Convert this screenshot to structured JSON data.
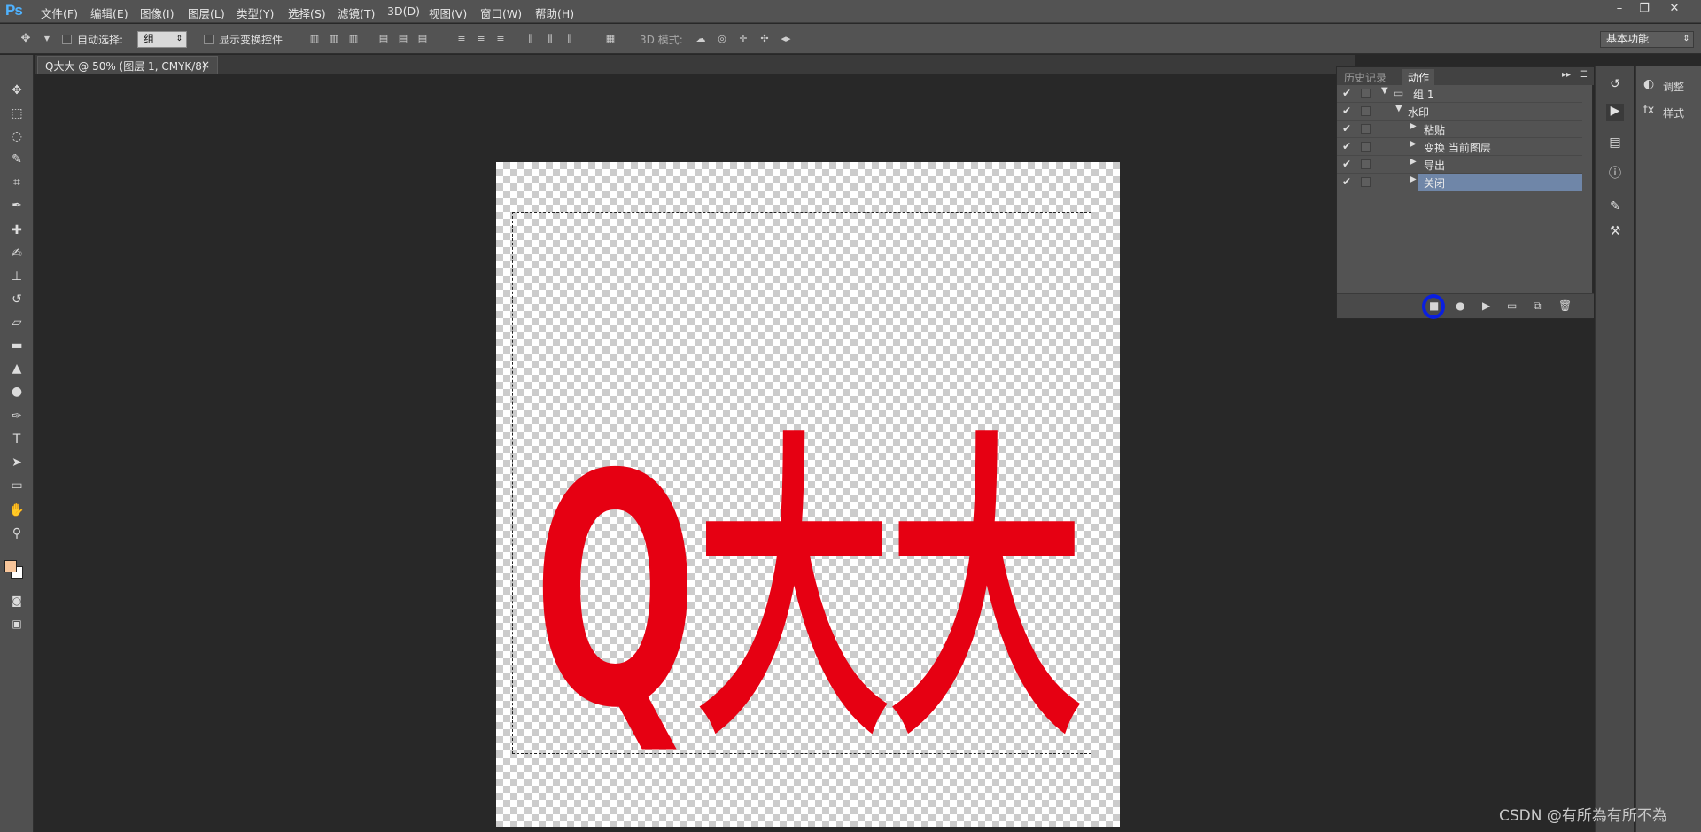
{
  "app": {
    "logo": "Ps"
  },
  "menu": [
    "文件(F)",
    "编辑(E)",
    "图像(I)",
    "图层(L)",
    "类型(Y)",
    "选择(S)",
    "滤镜(T)",
    "3D(D)",
    "视图(V)",
    "窗口(W)",
    "帮助(H)"
  ],
  "window": {
    "minimize": "–",
    "restore": "❐",
    "close": "✕"
  },
  "options": {
    "auto_select": "自动选择:",
    "auto_select_value": "组",
    "show_transform": "显示变换控件",
    "mode_3d": "3D 模式:",
    "workspace": "基本功能"
  },
  "document": {
    "tab_title": "Q大大 @ 50% (图层 1, CMYK/8)",
    "close": "×",
    "artwork_text": "Q大大",
    "artwork_color": "#e60012"
  },
  "colors": {
    "foreground": "#f7c59a",
    "background": "#ffffff",
    "highlight_circle": "#0a1fe0",
    "selected_row": "#6f86a8"
  },
  "panel": {
    "tabs": [
      "历史记录",
      "动作"
    ],
    "rows": [
      {
        "label": "组 1",
        "checked": true,
        "icon": "folder-icon"
      },
      {
        "label": "水印",
        "checked": true
      },
      {
        "label": "粘贴",
        "checked": true
      },
      {
        "label": "变换 当前图层",
        "checked": true
      },
      {
        "label": "导出",
        "checked": true
      },
      {
        "label": "关闭",
        "checked": true,
        "selected": true
      }
    ],
    "buttons": [
      "stop-icon",
      "record-icon",
      "play-icon",
      "new-set-icon",
      "new-action-icon",
      "delete-icon"
    ]
  },
  "side_panel": {
    "adjust": "调整",
    "styles": "样式"
  },
  "watermark": "CSDN @有所為有所不為"
}
